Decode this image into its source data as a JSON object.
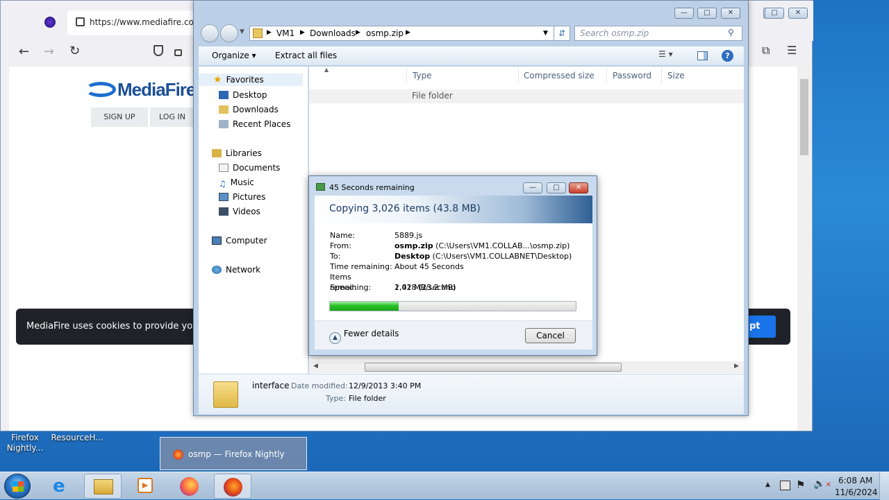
{
  "firefox": {
    "url": "https://www.mediafire.com/",
    "site_logo": "MediaFire",
    "sign_up": "SIGN UP",
    "log_in": "LOG IN",
    "cookie_text": "MediaFire uses cookies to provide you wit",
    "accept_partial": "pt"
  },
  "explorer": {
    "breadcrumb": [
      "VM1",
      "Downloads",
      "osmp.zip"
    ],
    "search_placeholder": "Search osmp.zip",
    "organize": "Organize",
    "extract": "Extract all files",
    "nav": {
      "favorites": "Favorites",
      "desktop": "Desktop",
      "downloads": "Downloads",
      "recent": "Recent Places",
      "libraries": "Libraries",
      "documents": "Documents",
      "music": "Music",
      "pictures": "Pictures",
      "videos": "Videos",
      "computer": "Computer",
      "network": "Network"
    },
    "columns": {
      "type": "Type",
      "compressed": "Compressed size",
      "password": "Password ...",
      "size": "Size"
    },
    "row_type": "File folder",
    "details": {
      "name": "interface",
      "date_label": "Date modified:",
      "date": "12/9/2013 3:40 PM",
      "type_label": "Type:",
      "type": "File folder"
    }
  },
  "dialog": {
    "title": "45 Seconds remaining",
    "heading": "Copying 3,026 items (43.8 MB)",
    "name_label": "Name:",
    "name": "5889.js",
    "from_label": "From:",
    "from_bold": "osmp.zip",
    "from_path": "(C:\\Users\\VM1.COLLAB...\\osmp.zip)",
    "to_label": "To:",
    "to_bold": "Desktop",
    "to_path": "(C:\\Users\\VM1.COLLABNET\\Desktop)",
    "time_label": "Time remaining:",
    "time": "About 45 Seconds",
    "items_label": "Items remaining:",
    "items": "2,418 (23.2 MB)",
    "speed_label": "Speed:",
    "speed": "1.02 MB/second",
    "progress": 0.28,
    "fewer": "Fewer details",
    "cancel": "Cancel"
  },
  "desktop": {
    "icon1": "Firefox Nightly...",
    "icon2": "ResourceH...",
    "thumb_title": "osmp — Firefox Nightly"
  },
  "tray": {
    "time": "6:08 AM",
    "date": "11/6/2024"
  }
}
